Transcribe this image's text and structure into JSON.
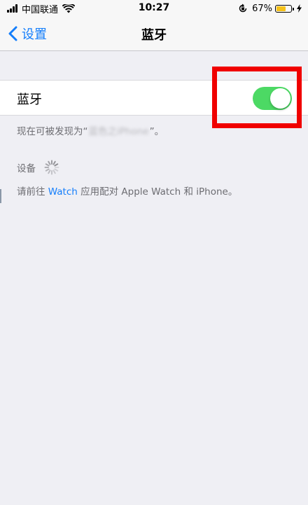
{
  "status_bar": {
    "carrier": "中国联通",
    "time": "10:27",
    "battery_percent": "67%",
    "battery_level": 0.67,
    "battery_color": "#f5c118",
    "icons": [
      "signal-icon",
      "wifi-icon",
      "orientation-lock-icon",
      "battery-icon",
      "charging-icon"
    ]
  },
  "nav": {
    "back_label": "设置",
    "title": "蓝牙"
  },
  "bluetooth": {
    "label": "蓝牙",
    "enabled": true,
    "toggle_color": "#4cd964"
  },
  "discoverable": {
    "prefix": "现在可被发现为“",
    "device_name": "蓝色之iPhone",
    "suffix": "”。"
  },
  "devices_header": "设备",
  "watch_hint": {
    "prefix": "请前往 ",
    "link": "Watch",
    "suffix": " 应用配对 Apple Watch 和 iPhone。"
  },
  "colors": {
    "accent": "#147efb",
    "highlight_box": "#f00000",
    "background": "#efeff4"
  }
}
